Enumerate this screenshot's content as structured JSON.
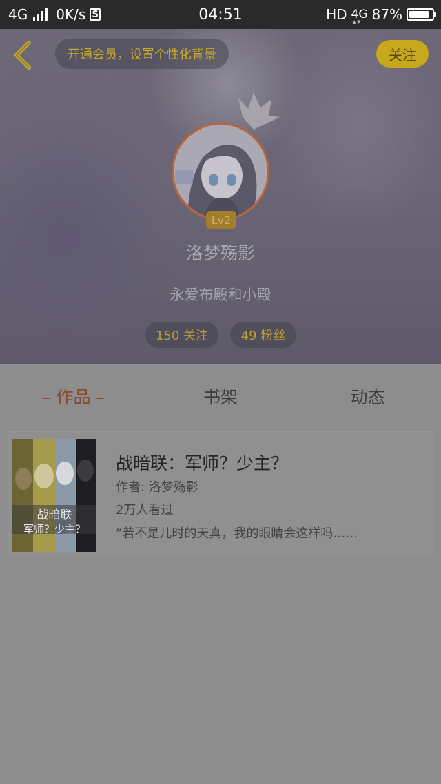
{
  "status_bar": {
    "network": "4G",
    "speed": "0K/s",
    "s_icon": "S",
    "time": "04:51",
    "hd": "HD",
    "network_right": "4G",
    "battery_text": "87%",
    "battery_level": 0.87
  },
  "header": {
    "back_icon": "chevron-left-icon",
    "vip_prompt": "开通会员，设置个性化背景",
    "follow_label": "关注",
    "level": "Lv2",
    "username": "洛梦殇影",
    "bio": "永爱布殿和小殿",
    "following": "150 关注",
    "fans": "49 粉丝"
  },
  "tabs": [
    {
      "label": "– 作品 –",
      "active": true
    },
    {
      "label": "书架",
      "active": false
    },
    {
      "label": "动态",
      "active": false
    }
  ],
  "works": [
    {
      "title": "战暗联：军师？少主？",
      "author": "作者: 洛梦殇影",
      "views": "2万人看过",
      "excerpt": "“若不是儿时的天真，我的眼睛会这样吗……",
      "cover_text": "战暗联 军师？少主？"
    }
  ],
  "colors": {
    "accent_gold": "#c7a81c",
    "active_tab": "#8b4a2c",
    "avatar_ring": "#b8633a"
  }
}
